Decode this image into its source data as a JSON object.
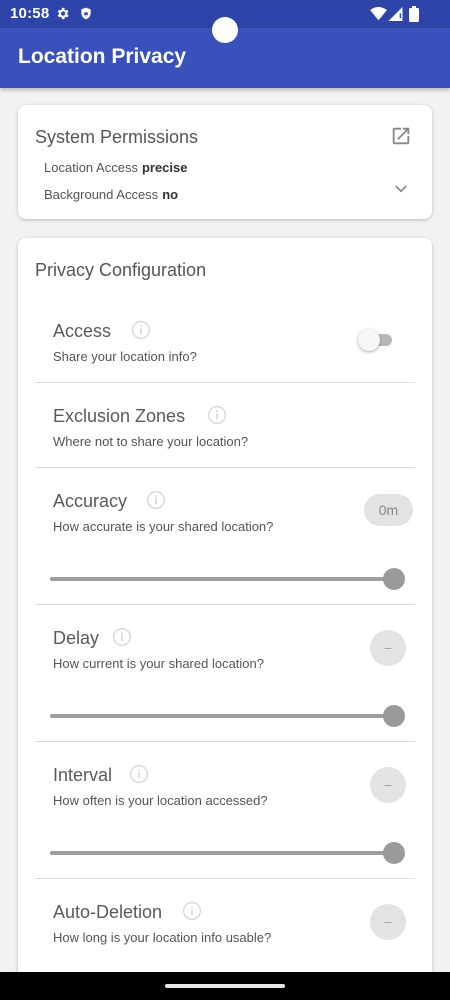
{
  "status_bar": {
    "time": "10:58",
    "icons": [
      "gear-icon",
      "shield-icon",
      "wifi-icon",
      "signal-icon",
      "battery-icon"
    ]
  },
  "app_bar": {
    "title": "Location Privacy"
  },
  "permissions": {
    "title": "System Permissions",
    "location_access_label": "Location Access",
    "location_access_value": "precise",
    "background_access_label": "Background Access",
    "background_access_value": "no"
  },
  "privacy": {
    "title": "Privacy Configuration",
    "access": {
      "title": "Access",
      "subtitle": "Share your location info?",
      "enabled": false
    },
    "exclusion_zones": {
      "title": "Exclusion Zones",
      "subtitle": "Where not to share your location?"
    },
    "accuracy": {
      "title": "Accuracy",
      "subtitle": "How accurate is your shared location?",
      "value": "0m",
      "slider_fraction": 1.0
    },
    "delay": {
      "title": "Delay",
      "subtitle": "How current is your shared location?",
      "value": "–",
      "slider_fraction": 1.0
    },
    "interval": {
      "title": "Interval",
      "subtitle": "How often is your location accessed?",
      "value": "–",
      "slider_fraction": 1.0
    },
    "auto_deletion": {
      "title": "Auto-Deletion",
      "subtitle": "How long is your location info usable?",
      "value": "–"
    }
  },
  "colors": {
    "status_bar": "#2f44a8",
    "app_bar": "#3a51bb",
    "background": "#f2f2f2"
  }
}
